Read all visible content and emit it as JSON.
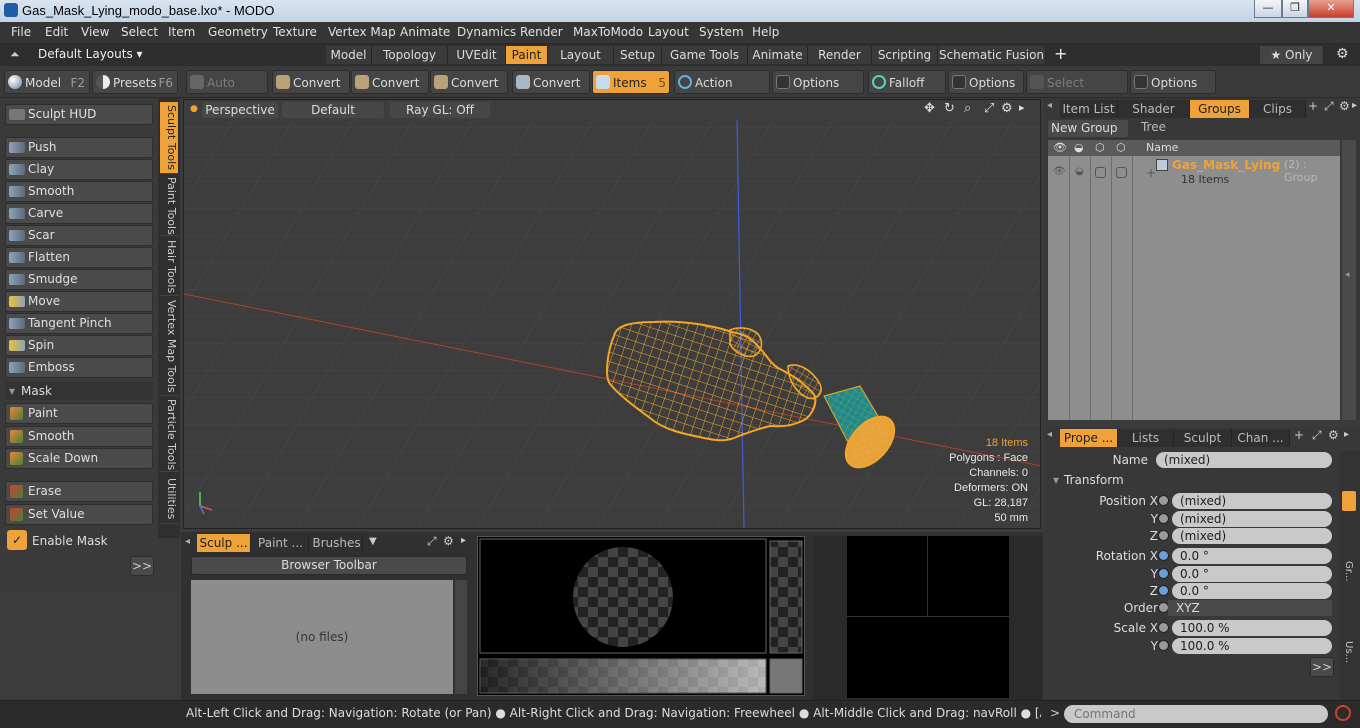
{
  "window": {
    "title": "Gas_Mask_Lying_modo_base.lxo* - MODO",
    "min_label": "—",
    "max_label": "❐",
    "close_label": "✕"
  },
  "menu": [
    "File",
    "Edit",
    "View",
    "Select",
    "Item",
    "Geometry",
    "Texture",
    "Vertex Map",
    "Animate",
    "Dynamics",
    "Render",
    "MaxToModo",
    "Layout",
    "System",
    "Help"
  ],
  "layouts": {
    "default_label": "Default Layouts ▾",
    "tabs": [
      "Model",
      "Topology",
      "UVEdit",
      "Paint",
      "Layout",
      "Setup",
      "Game Tools",
      "Animate",
      "Render",
      "Scripting",
      "Schematic Fusion"
    ],
    "active_tab": "Paint",
    "add_label": "+",
    "only_label": "★  Only",
    "gear_label": "⚙"
  },
  "toolbar": {
    "model_label": "Model",
    "model_key": "F2",
    "presets_label": "Presets",
    "presets_key": "F6",
    "auto_select": "Auto Select",
    "convert1": "Convert",
    "convert2": "Convert",
    "convert3": "Convert",
    "convert4": "Convert",
    "items_label": "Items",
    "items_key": "5",
    "action_center": "Action Center",
    "options1": "Options",
    "falloff": "Falloff",
    "options2": "Options",
    "select_through": "Select Through",
    "options3": "Options"
  },
  "sculpt": {
    "hud": "Sculpt HUD",
    "tools": [
      "Push",
      "Clay",
      "Smooth",
      "Carve",
      "Scar",
      "Flatten",
      "Smudge",
      "Move",
      "Tangent Pinch",
      "Spin",
      "Emboss"
    ],
    "mask_header": "Mask",
    "mask_tools": [
      "Paint",
      "Smooth",
      "Scale Down"
    ],
    "erase": "Erase",
    "set_value": "Set Value",
    "enable_mask": "Enable Mask",
    "expand": ">>"
  },
  "vertical_tabs": [
    "Sculpt Tools",
    "Paint Tools",
    "Hair Tools",
    "Vertex Map Tools",
    "Particle Tools",
    "Utilities"
  ],
  "viewport": {
    "view": "Perspective",
    "shading": "Default",
    "raygl": "Ray GL: Off",
    "stats": [
      "18 Items",
      "Polygons : Face",
      "Channels: 0",
      "Deformers: ON",
      "GL: 28,187",
      "50 mm"
    ]
  },
  "outliner": {
    "tabs": [
      "Item List",
      "Shader Tree",
      "Groups",
      "Clips"
    ],
    "active": "Groups",
    "new_group": "New Group",
    "col_name": "Name",
    "group_name": "Gas_Mask_Lying",
    "group_suffix": "(2) : Group",
    "group_items": "18 Items"
  },
  "properties": {
    "tabs": [
      "Prope ...",
      "Lists",
      "Sculpt",
      "Chan ..."
    ],
    "name_label": "Name",
    "name_value": "(mixed)",
    "transform_header": "Transform",
    "rows": [
      {
        "label": "Position X",
        "value": "(mixed)"
      },
      {
        "label": "Y",
        "value": "(mixed)"
      },
      {
        "label": "Z",
        "value": "(mixed)"
      },
      {
        "label": "Rotation X",
        "value": "0.0 °"
      },
      {
        "label": "Y",
        "value": "0.0 °"
      },
      {
        "label": "Z",
        "value": "0.0 °"
      },
      {
        "label": "Order",
        "value": "XYZ"
      },
      {
        "label": "Scale X",
        "value": "100.0 %"
      },
      {
        "label": "Y",
        "value": "100.0 %"
      }
    ],
    "expand": ">>"
  },
  "bottom": {
    "tabs": [
      "Sculp ...",
      "Paint ...",
      "Brushes"
    ],
    "browser_toolbar": "Browser Toolbar",
    "no_files": "(no files)"
  },
  "side_strip": [
    "Gr...",
    "Us..."
  ],
  "status": {
    "hint": "Alt-Left Click and Drag: Navigation: Rotate (or Pan) ● Alt-Right Click and Drag: Navigation: Freewheel ● Alt-Middle Click and Drag: navRoll ● [Any Key]-[Any Button] Click an ...",
    "command_placeholder": "Command"
  },
  "colors": {
    "accent": "#f0a23a",
    "mesh": "#f5a623",
    "teal": "#1e8a8a"
  }
}
